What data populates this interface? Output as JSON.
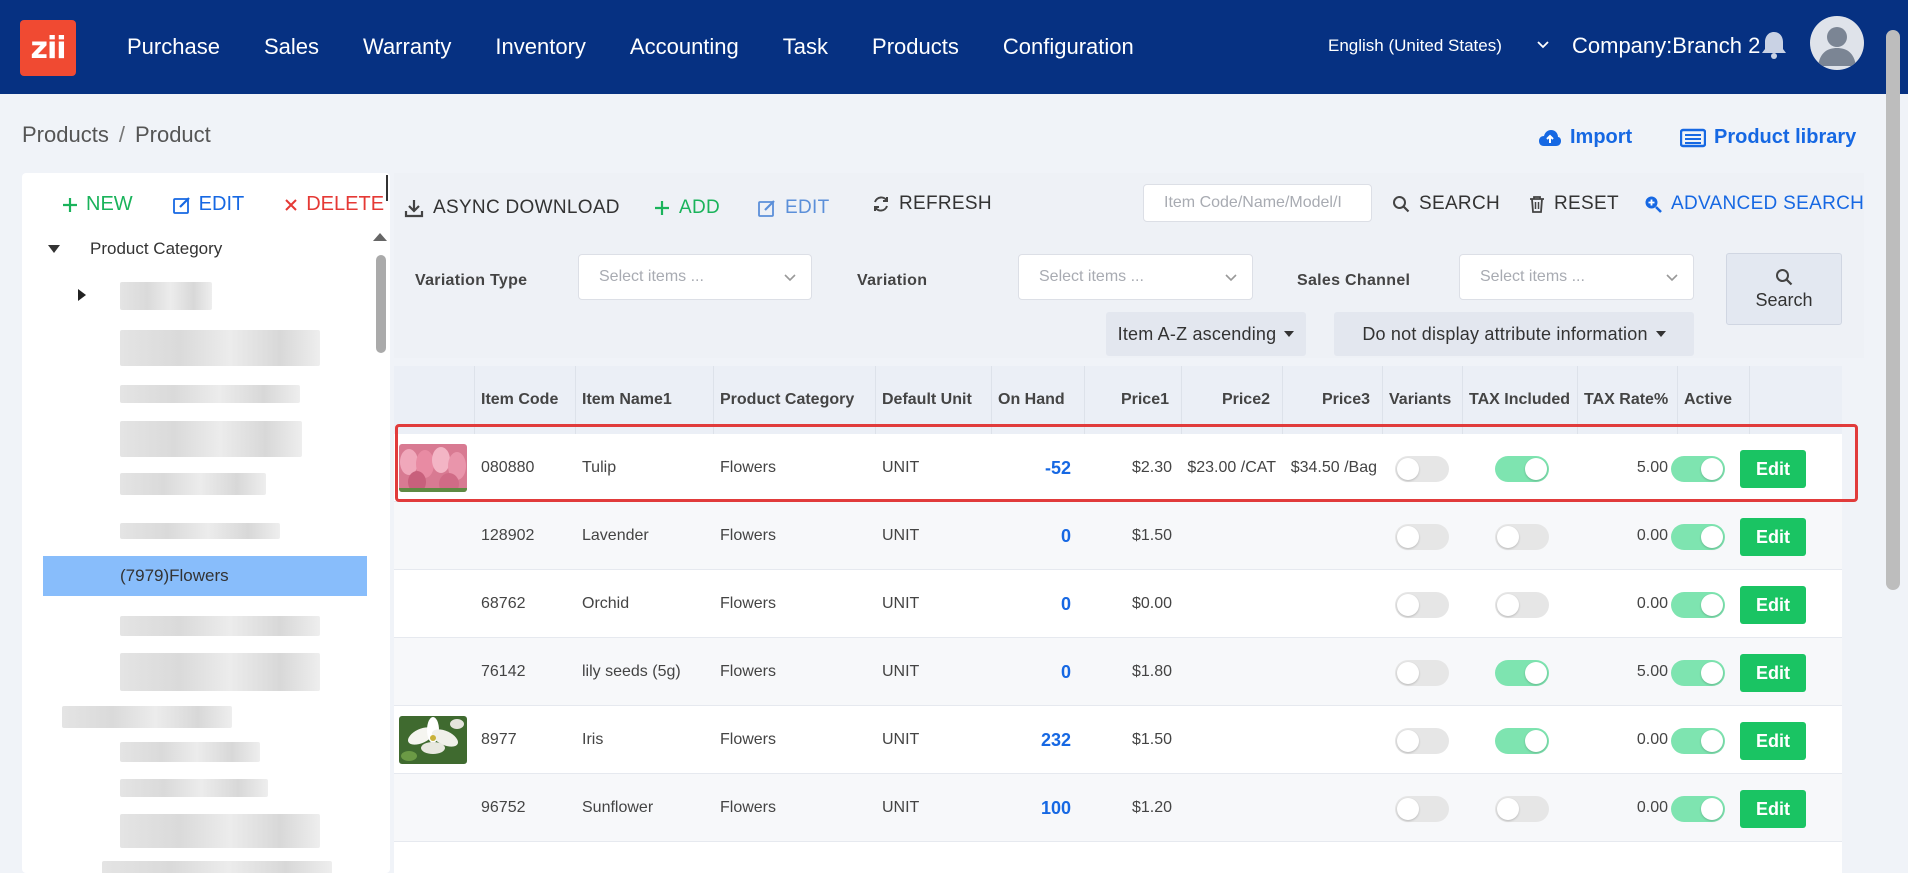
{
  "app": {
    "logo_text": "zii",
    "nav": [
      "Purchase",
      "Sales",
      "Warranty",
      "Inventory",
      "Accounting",
      "Task",
      "Products",
      "Configuration"
    ],
    "language": "English (United States)",
    "company": "Company:Branch 2"
  },
  "breadcrumb": {
    "root": "Products",
    "sep": "/",
    "current": "Product"
  },
  "top_actions": {
    "import": "Import",
    "library": "Product library"
  },
  "tree": {
    "new": "NEW",
    "edit": "EDIT",
    "delete": "DELETE",
    "root": "Product Category",
    "selected": "(7979)Flowers"
  },
  "toolbar": {
    "async_download": "ASYNC DOWNLOAD",
    "add": "ADD",
    "edit": "EDIT",
    "refresh": "REFRESH",
    "search_placeholder": "Item Code/Name/Model/I",
    "search": "SEARCH",
    "reset": "RESET",
    "advanced": "ADVANCED SEARCH"
  },
  "filters": {
    "variation_type_label": "Variation Type",
    "variation_label": "Variation",
    "sales_channel_label": "Sales Channel",
    "select_placeholder": "Select items ...",
    "search_button": "Search",
    "sort": "Item A-Z ascending",
    "attribute": "Do not display attribute information"
  },
  "table": {
    "headers": [
      "Item Code",
      "Item Name1",
      "Product Category",
      "Default Unit",
      "On Hand",
      "Price1",
      "Price2",
      "Price3",
      "Variants",
      "TAX Included",
      "TAX Rate%",
      "Active"
    ],
    "edit_label": "Edit",
    "rows": [
      {
        "code": "080880",
        "name": "Tulip",
        "category": "Flowers",
        "unit": "UNIT",
        "on_hand": "-52",
        "price1": "$2.30",
        "price2": "$23.00 /CAT",
        "price3": "$34.50 /Bag",
        "variants": false,
        "tax_included": true,
        "tax_rate": "5.00",
        "active": true,
        "image": "tulip"
      },
      {
        "code": "128902",
        "name": "Lavender",
        "category": "Flowers",
        "unit": "UNIT",
        "on_hand": "0",
        "price1": "$1.50",
        "price2": "",
        "price3": "",
        "variants": false,
        "tax_included": false,
        "tax_rate": "0.00",
        "active": true,
        "image": ""
      },
      {
        "code": "68762",
        "name": "Orchid",
        "category": "Flowers",
        "unit": "UNIT",
        "on_hand": "0",
        "price1": "$0.00",
        "price2": "",
        "price3": "",
        "variants": false,
        "tax_included": false,
        "tax_rate": "0.00",
        "active": true,
        "image": ""
      },
      {
        "code": "76142",
        "name": "lily seeds (5g)",
        "category": "Flowers",
        "unit": "UNIT",
        "on_hand": "0",
        "price1": "$1.80",
        "price2": "",
        "price3": "",
        "variants": false,
        "tax_included": true,
        "tax_rate": "5.00",
        "active": true,
        "image": ""
      },
      {
        "code": "8977",
        "name": "Iris",
        "category": "Flowers",
        "unit": "UNIT",
        "on_hand": "232",
        "price1": "$1.50",
        "price2": "",
        "price3": "",
        "variants": false,
        "tax_included": true,
        "tax_rate": "0.00",
        "active": true,
        "image": "lily"
      },
      {
        "code": "96752",
        "name": "Sunflower",
        "category": "Flowers",
        "unit": "UNIT",
        "on_hand": "100",
        "price1": "$1.20",
        "price2": "",
        "price3": "",
        "variants": false,
        "tax_included": false,
        "tax_rate": "0.00",
        "active": true,
        "image": ""
      }
    ]
  },
  "colors": {
    "nav_bg": "#063182",
    "accent_blue": "#1668e3",
    "accent_green": "#1ac463",
    "highlight": "#e13b3b",
    "tree_selected": "#88bdfb"
  }
}
